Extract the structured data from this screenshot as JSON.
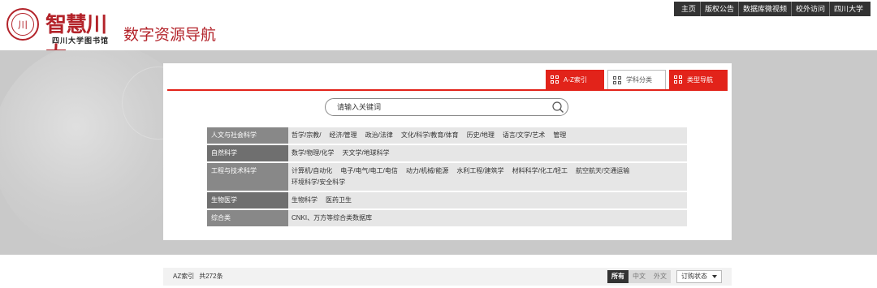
{
  "header": {
    "logo_big": "智慧川大",
    "logo_small": "四川大学图书馆",
    "logo_seal_char": "川",
    "title": "数字资源导航"
  },
  "topnav": [
    "主页",
    "版权公告",
    "数据库微视频",
    "校外访问",
    "四川大学"
  ],
  "tabs": [
    {
      "label": "A-Z索引",
      "style": "red"
    },
    {
      "label": "学科分类",
      "style": "white"
    },
    {
      "label": "类型导航",
      "style": "red"
    }
  ],
  "search": {
    "placeholder": "请输入关键词",
    "icon": "search-icon"
  },
  "categories": [
    {
      "label": "人文与社会科学",
      "items": [
        "哲学/宗教/",
        "经济/管理",
        "政治/法律",
        "文化/科学/教育/体育",
        "历史/地理",
        "语言/文学/艺术",
        "管理"
      ]
    },
    {
      "label": "自然科学",
      "items": [
        "数学/物理/化学",
        "天文学/地球科学"
      ]
    },
    {
      "label": "工程与技术科学",
      "items": [
        "计算机/自动化",
        "电子/电气/电工/电信",
        "动力/机械/能源",
        "水利工程/建筑学",
        "材料科学/化工/轻工",
        "航空航天/交通运输",
        "环境科学/安全科学"
      ]
    },
    {
      "label": "生物医学",
      "items": [
        "生物科学",
        "医药卫生"
      ]
    },
    {
      "label": "综合类",
      "items": [
        "CNKI、万方等综合类数据库"
      ]
    }
  ],
  "listbar": {
    "az_label": "AZ索引",
    "count": "共272条",
    "langs": [
      "所有",
      "中文",
      "外文"
    ],
    "order_label": "订购状态"
  },
  "colors": {
    "accent": "#e2231a",
    "brand": "#b3232a"
  }
}
